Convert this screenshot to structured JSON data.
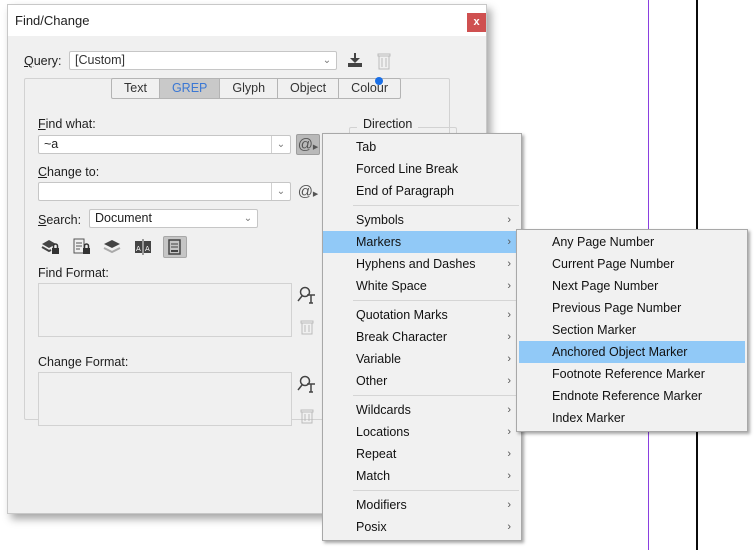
{
  "canvas": {
    "guides": [
      "purple-guide",
      "black-guide"
    ]
  },
  "dialog": {
    "title": "Find/Change",
    "close_label": "x",
    "query": {
      "label_u": "Q",
      "label_rest": "uery:",
      "value": "[Custom]"
    },
    "tabs": [
      {
        "label": "Text",
        "active": false
      },
      {
        "label": "GREP",
        "active": true
      },
      {
        "label": "Glyph",
        "active": false
      },
      {
        "label": "Object",
        "active": false
      },
      {
        "label": "Colour",
        "active": false
      }
    ],
    "find_what": {
      "label_u": "F",
      "label_rest": "ind what:",
      "value": "~a"
    },
    "change_to": {
      "label_u": "C",
      "label_rest": "hange to:",
      "value": ""
    },
    "search": {
      "label_u": "S",
      "label_rest": "earch:",
      "value": "Document"
    },
    "direction_label": "Direction",
    "find_format_label": "Find Format:",
    "change_format_label": "Change Format:",
    "special_char_glyph": "@",
    "colors": {
      "accent": "#3b78d4",
      "close": "#cf5050",
      "highlight": "#91c9f7",
      "dot": "#1a6fe6"
    }
  },
  "menu": {
    "groups": [
      [
        {
          "label": "Tab",
          "sub": false
        },
        {
          "label": "Forced Line Break",
          "sub": false
        },
        {
          "label": "End of Paragraph",
          "sub": false
        }
      ],
      [
        {
          "label": "Symbols",
          "sub": true
        },
        {
          "label": "Markers",
          "sub": true,
          "highlight": true
        },
        {
          "label": "Hyphens and Dashes",
          "sub": true
        },
        {
          "label": "White Space",
          "sub": true
        }
      ],
      [
        {
          "label": "Quotation Marks",
          "sub": true
        },
        {
          "label": "Break Character",
          "sub": true
        },
        {
          "label": "Variable",
          "sub": true
        },
        {
          "label": "Other",
          "sub": true
        }
      ],
      [
        {
          "label": "Wildcards",
          "sub": true
        },
        {
          "label": "Locations",
          "sub": true
        },
        {
          "label": "Repeat",
          "sub": true
        },
        {
          "label": "Match",
          "sub": true
        }
      ],
      [
        {
          "label": "Modifiers",
          "sub": true
        },
        {
          "label": "Posix",
          "sub": true
        }
      ]
    ]
  },
  "submenu": {
    "items": [
      {
        "label": "Any Page Number"
      },
      {
        "label": "Current Page Number"
      },
      {
        "label": "Next Page Number"
      },
      {
        "label": "Previous Page Number"
      },
      {
        "label": "Section Marker"
      },
      {
        "label": "Anchored Object Marker",
        "highlight": true
      },
      {
        "label": "Footnote Reference Marker"
      },
      {
        "label": "Endnote Reference Marker"
      },
      {
        "label": "Index Marker"
      }
    ]
  }
}
